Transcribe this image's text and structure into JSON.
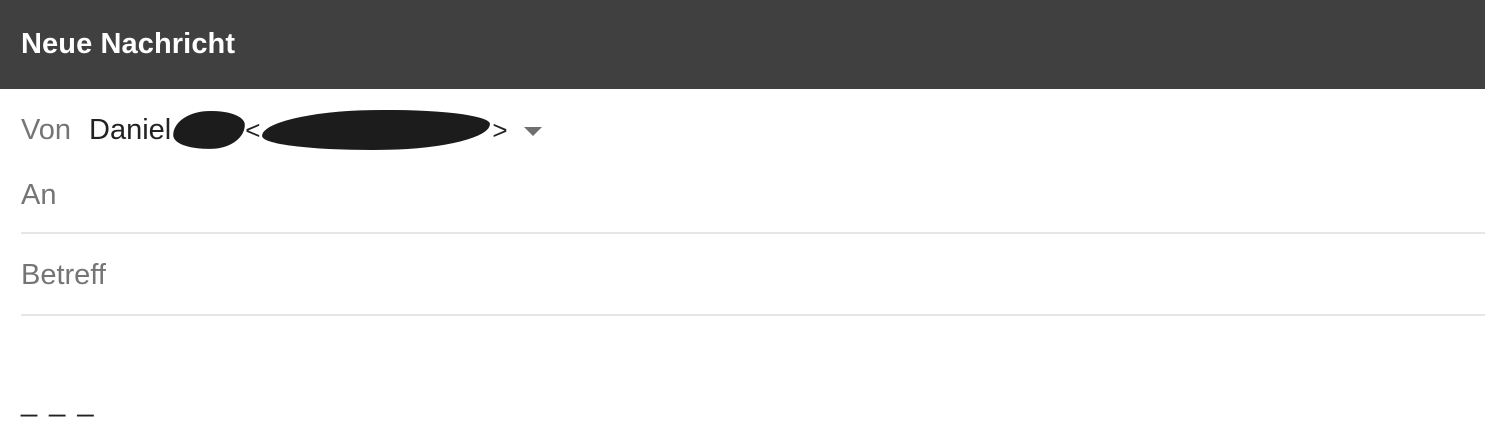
{
  "header": {
    "title": "Neue Nachricht"
  },
  "from": {
    "label": "Von",
    "name": "Daniel",
    "open_angle": "<",
    "close_angle": ">",
    "dropdown_icon": "arrow-drop-down-icon"
  },
  "to": {
    "placeholder": "An",
    "value": ""
  },
  "subject": {
    "placeholder": "Betreff",
    "value": ""
  },
  "body": {
    "signature": "_ _ _"
  },
  "colors": {
    "header_bg": "#404040",
    "header_text": "#ffffff",
    "label_text": "#757575",
    "divider": "#e6e6e6"
  }
}
